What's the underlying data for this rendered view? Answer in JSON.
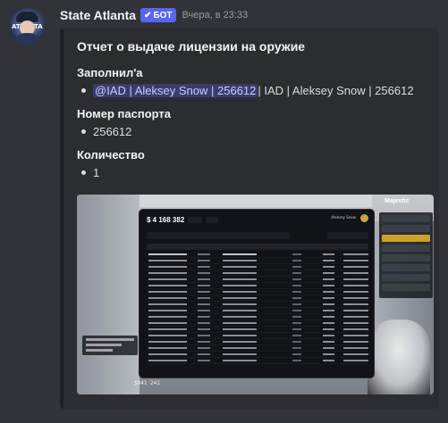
{
  "message": {
    "author": "State Atlanta",
    "bot_badge": "БОТ",
    "timestamp": "Вчера, в 23:33",
    "avatar_text": "ATLANTA"
  },
  "embed": {
    "title": "Отчет о выдаче лицензии на оружие",
    "fields": [
      {
        "name": "Заполнил'a",
        "mention": "@IAD | Aleksey Snow | 256612",
        "value": " | IAD | Aleksey Snow | 256612"
      },
      {
        "name": "Номер паспорта",
        "value": "256612"
      },
      {
        "name": "Количество",
        "value": "1"
      }
    ]
  },
  "screenshot": {
    "balance": "$ 4 168 382",
    "logo": "Majestic",
    "panel_user": "Aleksey Snow",
    "money": "$841 241"
  },
  "colors": {
    "background": "#323339",
    "embed_bg": "#2b2d31",
    "bot_badge": "#5865f2",
    "mention_text": "#c9cdfb"
  },
  "icons": [
    "checkmark-icon",
    "avatar-image",
    "screenshot-image"
  ]
}
